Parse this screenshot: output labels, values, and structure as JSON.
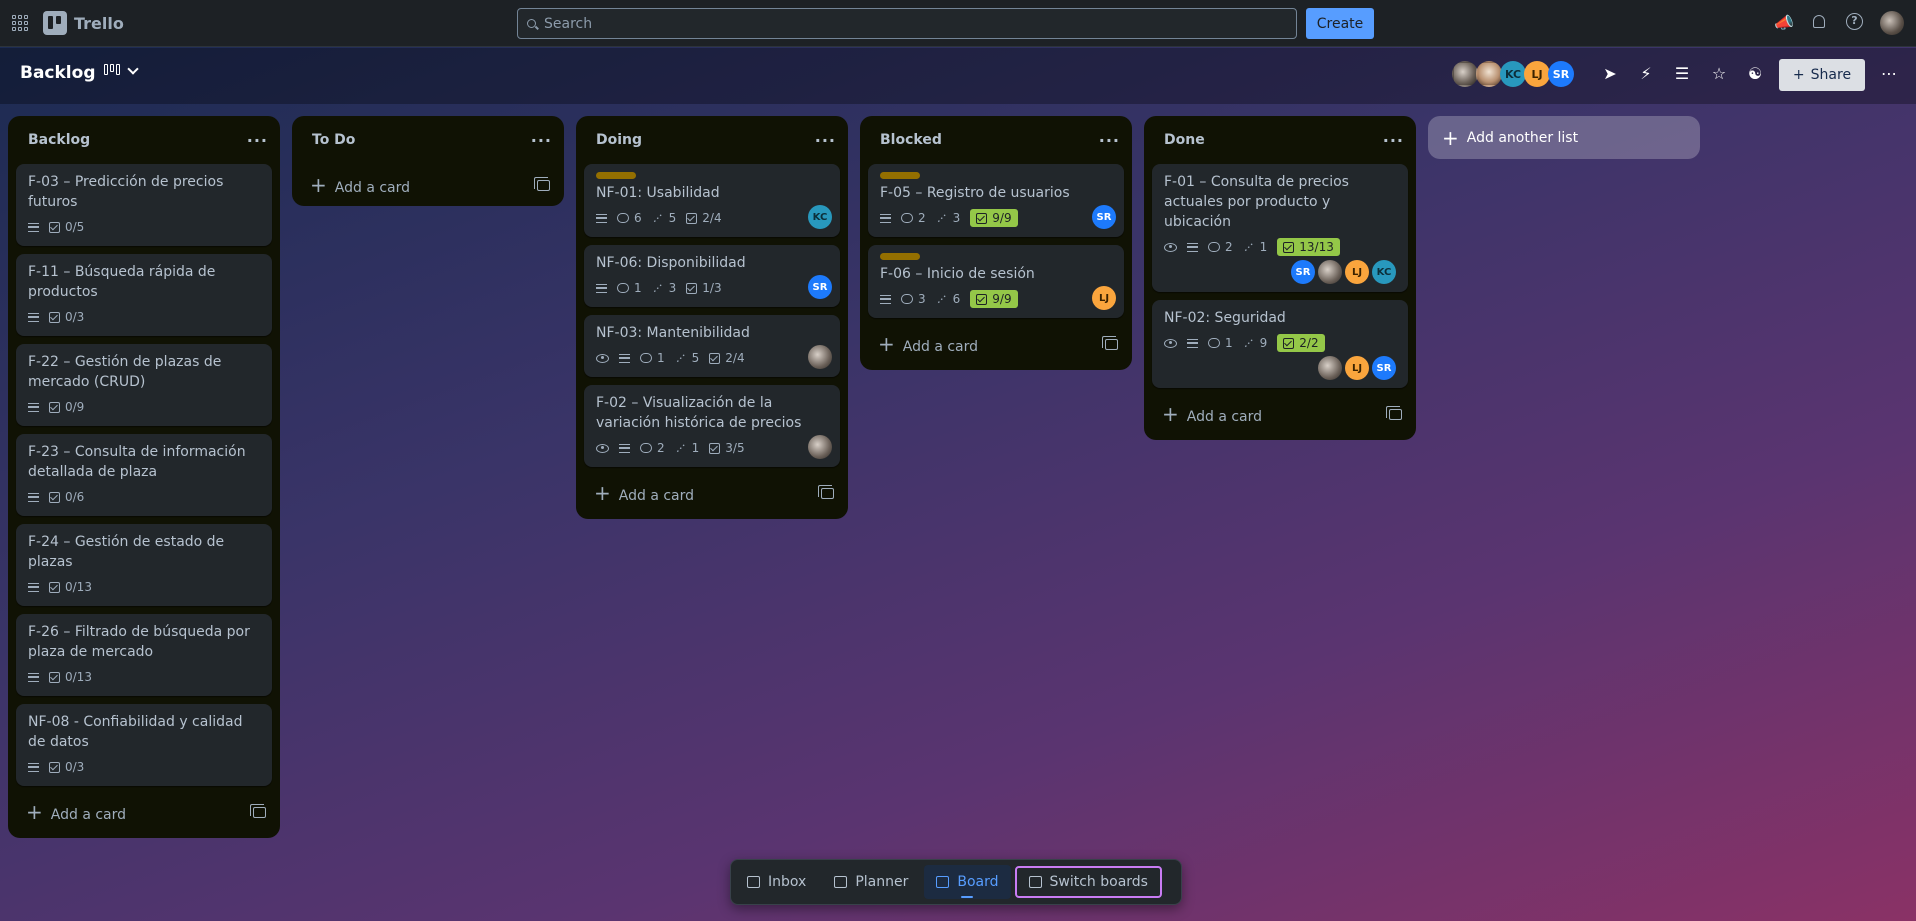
{
  "app": {
    "name": "Trello"
  },
  "search": {
    "placeholder": "Search"
  },
  "top_actions": {
    "create_label": "Create"
  },
  "board": {
    "title": "Backlog",
    "share_label": "Share",
    "members": [
      "KC",
      "LJ",
      "SR"
    ]
  },
  "lists": [
    {
      "title": "Backlog",
      "add_label": "Add a card",
      "cards": [
        {
          "title": "F-03 – Predicción de precios futuros",
          "checklist": "0/5"
        },
        {
          "title": "F-11 – Búsqueda rápida de productos",
          "checklist": "0/3"
        },
        {
          "title": "F-22 – Gestión de plazas de mercado (CRUD)",
          "checklist": "0/9"
        },
        {
          "title": "F-23 – Consulta de información detallada de plaza",
          "checklist": "0/6"
        },
        {
          "title": "F-24 – Gestión de estado de plazas",
          "checklist": "0/13"
        },
        {
          "title": "F-26 – Filtrado de búsqueda por plaza de mercado",
          "checklist": "0/13"
        },
        {
          "title": "NF-08 - Confiabilidad y calidad de datos",
          "checklist": "0/3"
        }
      ]
    },
    {
      "title": "To Do",
      "add_label": "Add a card",
      "cards": []
    },
    {
      "title": "Doing",
      "add_label": "Add a card",
      "cards": [
        {
          "title": "NF-01: Usabilidad",
          "comments": "6",
          "attachments": "5",
          "checklist": "2/4",
          "member": "KC"
        },
        {
          "title": "NF-06: Disponibilidad",
          "comments": "1",
          "attachments": "3",
          "checklist": "1/3",
          "member": "SR"
        },
        {
          "title": "NF-03: Mantenibilidad",
          "comments": "1",
          "attachments": "5",
          "checklist": "2/4"
        },
        {
          "title": "F-02 – Visualización de la variación histórica de precios",
          "comments": "2",
          "attachments": "1",
          "checklist": "3/5"
        }
      ]
    },
    {
      "title": "Blocked",
      "add_label": "Add a card",
      "cards": [
        {
          "title": "F-05 – Registro de usuarios",
          "comments": "2",
          "attachments": "3",
          "checklist": "9/9",
          "member": "SR"
        },
        {
          "title": "F-06 – Inicio de sesión",
          "comments": "3",
          "attachments": "6",
          "checklist": "9/9",
          "member": "LJ"
        }
      ]
    },
    {
      "title": "Done",
      "add_label": "Add a card",
      "cards": [
        {
          "title": "F-01 – Consulta de precios actuales por producto y ubicación",
          "comments": "2",
          "attachments": "1",
          "checklist": "13/13",
          "members": [
            "SR",
            "LJ",
            "KC"
          ]
        },
        {
          "title": "NF-02: Seguridad",
          "comments": "1",
          "attachments": "9",
          "checklist": "2/2",
          "members": [
            "LJ",
            "SR"
          ]
        }
      ]
    }
  ],
  "add_list_label": "Add another list",
  "bottom_nav": {
    "inbox": "Inbox",
    "planner": "Planner",
    "board": "Board",
    "switch": "Switch boards"
  },
  "colors": {
    "accent": "#579dff",
    "label_yellow": "#946f00",
    "done_green": "#94c748",
    "kc": "#2898bd",
    "lj": "#faa53d",
    "sr": "#1d7afc"
  }
}
